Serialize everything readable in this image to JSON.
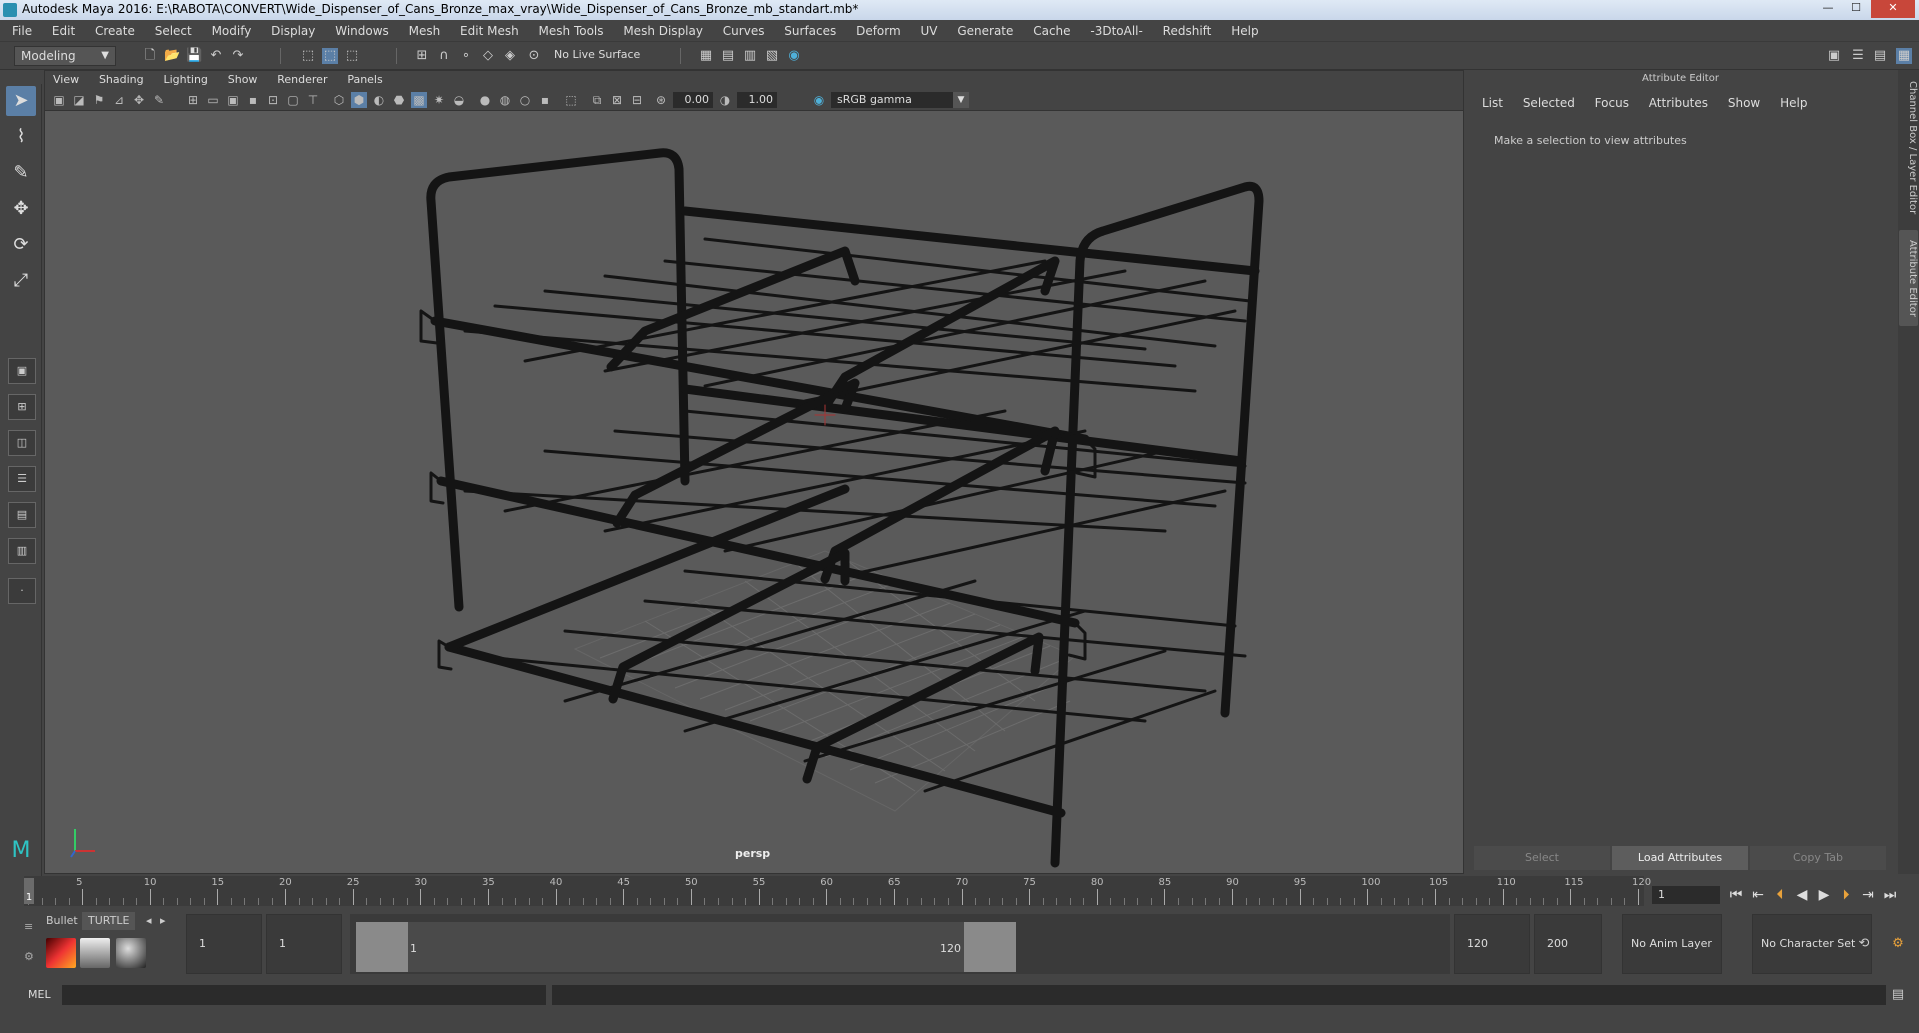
{
  "window": {
    "title": "Autodesk Maya 2016: E:\\RABOTA\\CONVERT\\Wide_Dispenser_of_Cans_Bronze_max_vray\\Wide_Dispenser_of_Cans_Bronze_mb_standart.mb*",
    "minimize": "—",
    "maximize": "☐",
    "close": "✕"
  },
  "menubar": [
    "File",
    "Edit",
    "Create",
    "Select",
    "Modify",
    "Display",
    "Windows",
    "Mesh",
    "Edit Mesh",
    "Mesh Tools",
    "Mesh Display",
    "Curves",
    "Surfaces",
    "Deform",
    "UV",
    "Generate",
    "Cache",
    "-3DtoAll-",
    "Redshift",
    "Help"
  ],
  "statusline": {
    "mode": "Modeling",
    "live_surface": "No Live Surface"
  },
  "viewport": {
    "menu": [
      "View",
      "Shading",
      "Lighting",
      "Show",
      "Renderer",
      "Panels"
    ],
    "exposure": "0.00",
    "gamma": "1.00",
    "color_space": "sRGB gamma",
    "camera": "persp"
  },
  "attribute_editor": {
    "title": "Attribute Editor",
    "menu": [
      "List",
      "Selected",
      "Focus",
      "Attributes",
      "Show",
      "Help"
    ],
    "message": "Make a selection to view attributes",
    "buttons": {
      "select": "Select",
      "load": "Load Attributes",
      "copy": "Copy Tab"
    }
  },
  "side_tabs": {
    "channel_box": "Channel Box / Layer Editor",
    "attribute_editor": "Attribute Editor"
  },
  "timeline": {
    "start": 1,
    "end": 120,
    "tick_labels": [
      "5",
      "10",
      "15",
      "20",
      "25",
      "30",
      "35",
      "40",
      "45",
      "50",
      "55",
      "60",
      "65",
      "70",
      "75",
      "80",
      "85",
      "90",
      "95",
      "100",
      "105",
      "110",
      "115",
      "120"
    ],
    "current_frame": "1",
    "current_frame_field": "1"
  },
  "range": {
    "shelf_tabs": [
      "Bullet",
      "TURTLE"
    ],
    "start_field": "1",
    "playback_start": "1",
    "range_start_label": "1",
    "range_end_label": "120",
    "playback_end": "120",
    "end_field": "200",
    "anim_layer": "No Anim Layer",
    "character_set": "No Character Set"
  },
  "cmdline": {
    "label": "MEL"
  },
  "colors": {
    "accent": "#5b7fa6",
    "viewport_bg": "#5a5a5a",
    "panel_bg": "#444444"
  }
}
